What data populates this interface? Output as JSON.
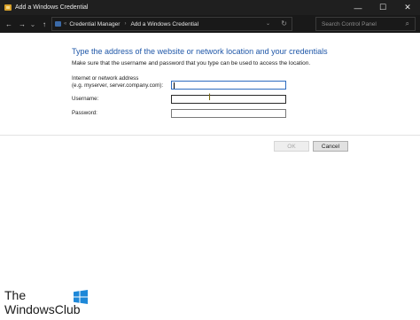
{
  "window": {
    "title": "Add a Windows Credential",
    "minimize_glyph": "—",
    "maximize_glyph": "☐",
    "close_glyph": "✕"
  },
  "nav": {
    "back_glyph": "←",
    "forward_glyph": "→",
    "recent_glyph": "⌄",
    "up_glyph": "↑"
  },
  "address": {
    "overflow": "«",
    "crumbs": [
      "Credential Manager",
      "Add a Windows Credential"
    ],
    "separator": "›",
    "dropdown_glyph": "⌄",
    "refresh_glyph": "↻"
  },
  "search": {
    "placeholder": "Search Control Panel",
    "icon": "search-icon",
    "glyph": "⌕"
  },
  "form": {
    "heading": "Type the address of the website or network location and your credentials",
    "subtext": "Make sure that the username and password that you type can be used to access the location.",
    "address_label_line1": "Internet or network address",
    "address_label_line2": "(e.g. myserver, server.company.com):",
    "address_value": "",
    "username_label": "Username:",
    "username_value": "",
    "password_label": "Password:",
    "password_value": ""
  },
  "buttons": {
    "ok": "OK",
    "cancel": "Cancel"
  },
  "watermark": {
    "line1": "The",
    "line2": "WindowsClub"
  },
  "colors": {
    "titlebar": "#1f1f1f",
    "heading_blue": "#1f57a8",
    "focus_border": "#2d6cc0"
  }
}
